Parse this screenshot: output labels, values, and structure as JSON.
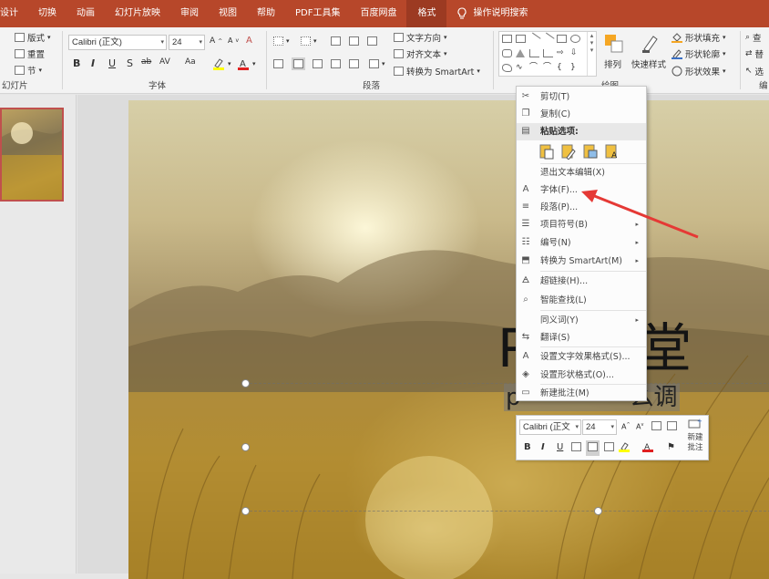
{
  "tabs": [
    "设计",
    "切换",
    "动画",
    "幻灯片放映",
    "审阅",
    "视图",
    "帮助",
    "PDF工具集",
    "百度网盘",
    "格式"
  ],
  "tell_me": "操作说明搜索",
  "ribbon": {
    "slides_group": {
      "layout": "版式",
      "reset": "重置",
      "section": "节",
      "label": "幻灯片"
    },
    "font_group": {
      "font_name": "Calibri (正文)",
      "font_size": "24",
      "label": "字体",
      "buttons": [
        "B",
        "I",
        "U",
        "S",
        "ab",
        "AV",
        "Aa"
      ]
    },
    "paragraph_group": {
      "text_direction": "文字方向",
      "align_text": "对齐文本",
      "convert_smartart": "转换为 SmartArt",
      "label": "段落"
    },
    "drawing_group": {
      "arrange": "排列",
      "quick_styles": "快速样式",
      "shape_fill": "形状填充",
      "shape_outline": "形状轮廓",
      "shape_effects": "形状效果",
      "label": "绘图"
    },
    "editing_group": {
      "find": "查",
      "replace": "替",
      "select": "选",
      "label": "编"
    }
  },
  "slide": {
    "title_visible": "P",
    "title_tail": "堂",
    "subtitle_lead": "p",
    "subtitle_tail": "么调"
  },
  "context_menu": {
    "cut": "剪切(T)",
    "copy": "复制(C)",
    "paste_header": "粘贴选项:",
    "exit_edit": "退出文本编辑(X)",
    "font": "字体(F)...",
    "paragraph": "段落(P)...",
    "bullets": "项目符号(B)",
    "numbering": "编号(N)",
    "convert_smartart": "转换为 SmartArt(M)",
    "hyperlink": "超链接(H)...",
    "smart_lookup": "智能查找(L)",
    "synonyms": "同义词(Y)",
    "translate": "翻译(S)",
    "text_effects": "设置文字效果格式(S)...",
    "shape_format": "设置形状格式(O)...",
    "new_comment": "新建批注(M)"
  },
  "mini_toolbar": {
    "font_name": "Calibri (正文",
    "font_size": "24",
    "new_comment_line1": "新建",
    "new_comment_line2": "批注"
  },
  "colors": {
    "accent": "#b7472a",
    "arrow": "#e53935",
    "font_color_bar": "#e02020",
    "highlight_bar": "#ffff00"
  }
}
